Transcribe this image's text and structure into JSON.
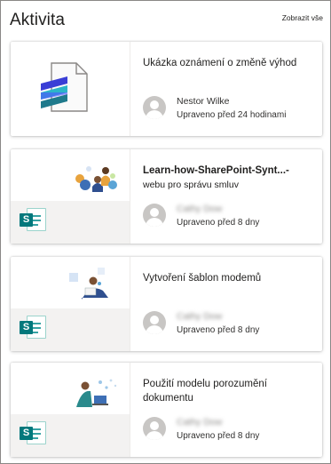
{
  "header": {
    "title": "Aktivita",
    "see_all": "Zobrazit vše"
  },
  "cards": [
    {
      "title": "Ukázka oznámení o změně výhod",
      "subtitle": "",
      "person": "Nestor Wilke",
      "modified": "Upraveno před 24 hodinami",
      "thumbnail_icon": "stream-file-icon"
    },
    {
      "title": "Learn-how-SharePoint-Synt...-",
      "subtitle": "webu pro správu smluv",
      "person": "Cathy Dow",
      "modified": "Upraveno před 8 dny",
      "thumbnail_icon": "sharepoint-page-icon"
    },
    {
      "title": "Vytvoření šablon modemů",
      "subtitle": "",
      "person": "Cathy Dow",
      "modified": "Upraveno před 8 dny",
      "thumbnail_icon": "sharepoint-page-icon"
    },
    {
      "title": "Použití modelu porozumění dokumentu",
      "subtitle": "",
      "person": "Cathy Dow",
      "modified": "Upraveno před 8 dny",
      "thumbnail_icon": "sharepoint-page-icon"
    }
  ],
  "colors": {
    "sharepoint_teal": "#03787c",
    "border": "#8a8886"
  }
}
